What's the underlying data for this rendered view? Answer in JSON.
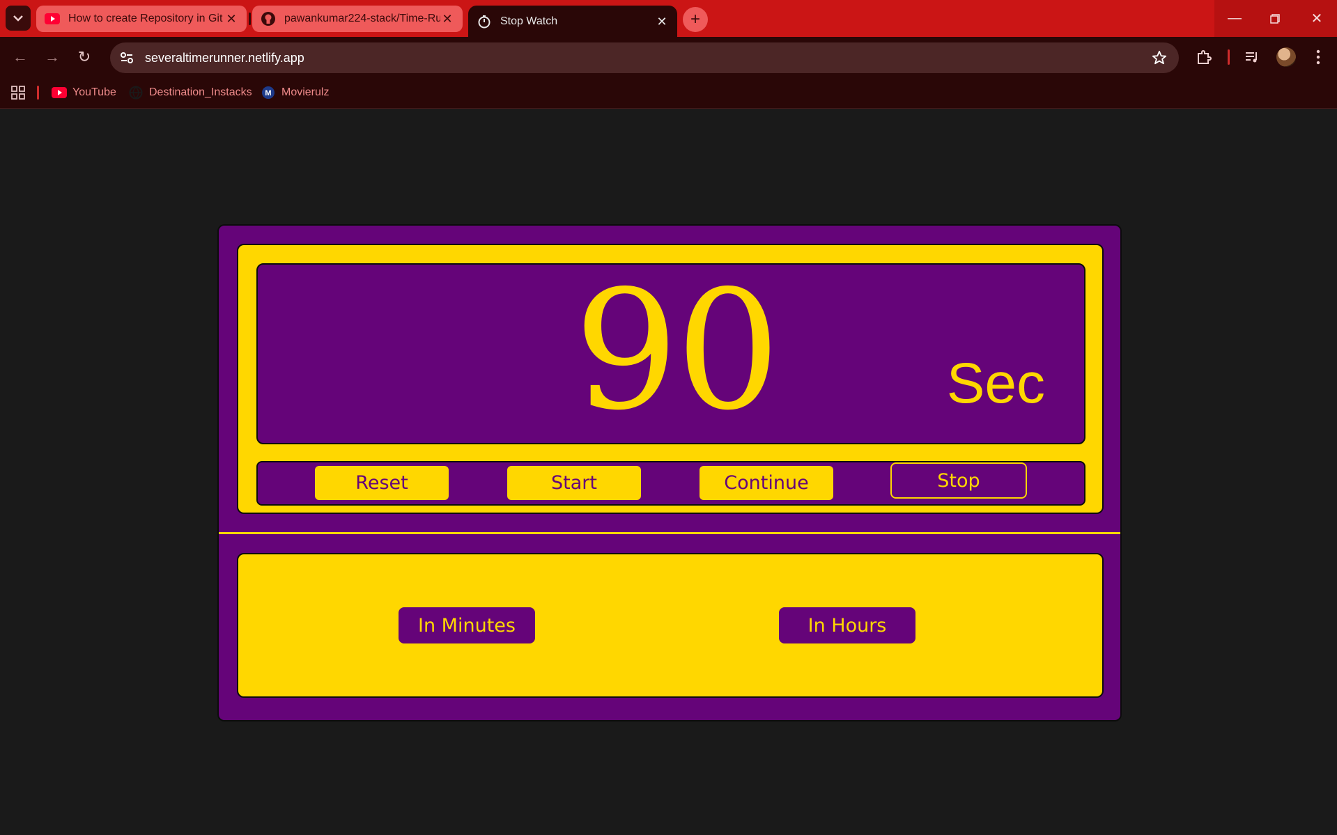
{
  "browser": {
    "tabs": [
      {
        "title": "How to create Repository in Git",
        "icon": "youtube-icon",
        "active": false
      },
      {
        "title": "pawankumar224-stack/Time-Ru",
        "icon": "github-icon",
        "active": false
      },
      {
        "title": "Stop Watch",
        "icon": "site-favicon",
        "active": true
      }
    ],
    "url": "severaltimerunner.netlify.app",
    "bookmarks": [
      {
        "label": "YouTube",
        "icon": "youtube-icon"
      },
      {
        "label": "Destination_Instacks",
        "icon": "globe-icon"
      },
      {
        "label": "Movierulz",
        "icon": "movierulz-icon"
      }
    ],
    "accent_color": "#cb1515"
  },
  "stopwatch": {
    "count": "90",
    "unit": "Sec",
    "buttons": {
      "reset": "Reset",
      "start": "Start",
      "continue": "Continue",
      "stop": "Stop"
    },
    "converters": {
      "minutes": "In Minutes",
      "hours": "In Hours"
    },
    "colors": {
      "purple": "#650479",
      "yellow": "#ffd700"
    }
  }
}
